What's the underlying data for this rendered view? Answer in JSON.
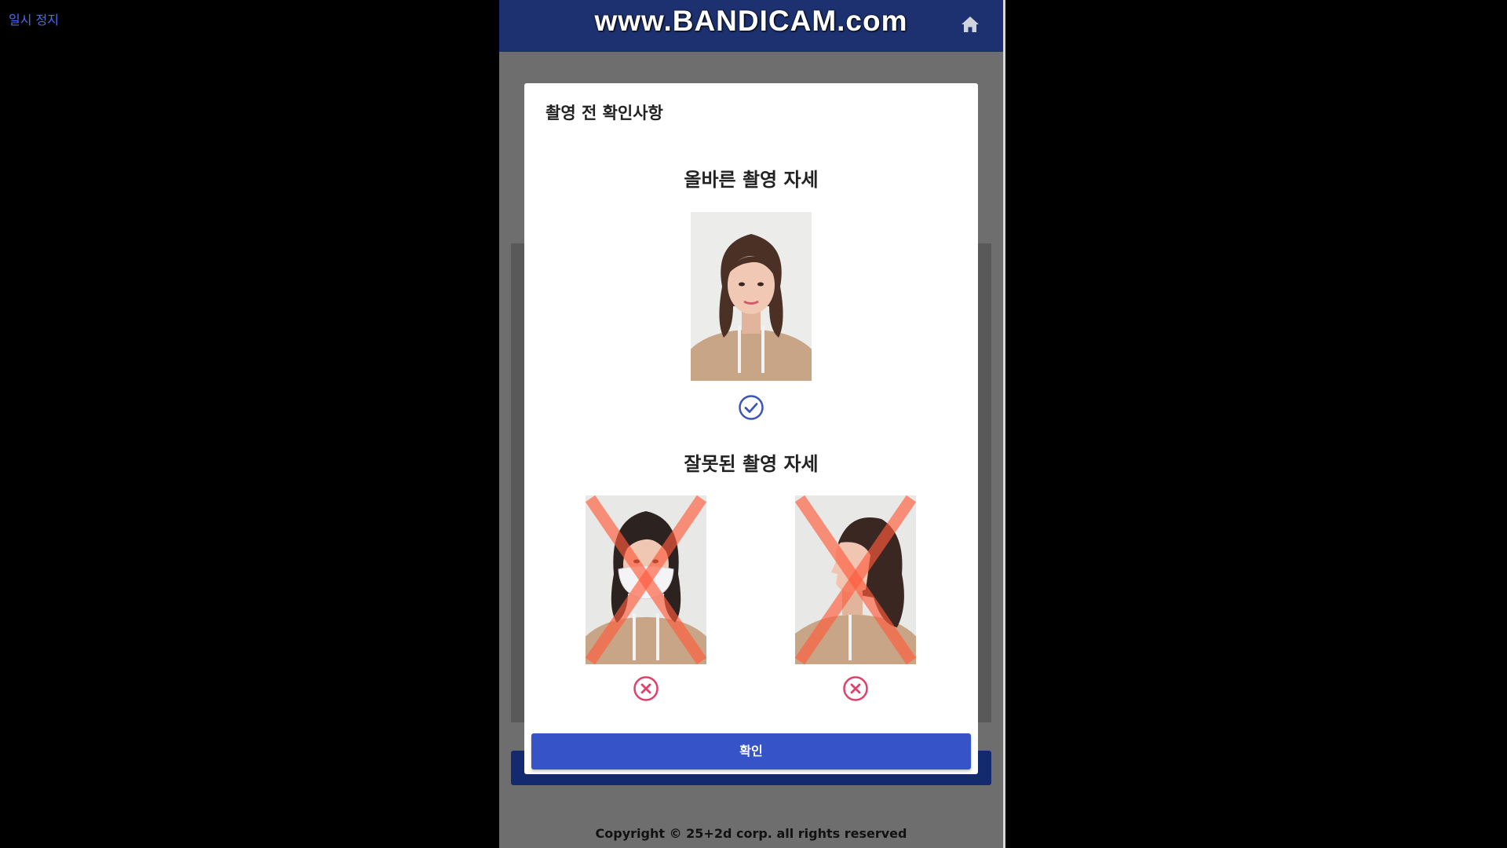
{
  "player": {
    "pause_label": "일시 정지"
  },
  "recorder": {
    "watermark": "www.BANDICAM.com"
  },
  "app": {
    "header": {
      "home_icon": "home-icon"
    },
    "footer": "Copyright © 25+2d corp. all rights reserved"
  },
  "modal": {
    "title": "촬영 전 확인사항",
    "correct": {
      "heading": "올바른 촬영 자세",
      "status_icon": "check-circle-icon"
    },
    "incorrect": {
      "heading": "잘못된 촬영 자세",
      "status_icon": "x-circle-icon"
    },
    "confirm_label": "확인"
  },
  "colors": {
    "header": "#1d3170",
    "confirm_button": "#3653c8",
    "check": "#3b55b8",
    "cross": "#e0406a",
    "x_overlay": "#ff5a3c"
  }
}
